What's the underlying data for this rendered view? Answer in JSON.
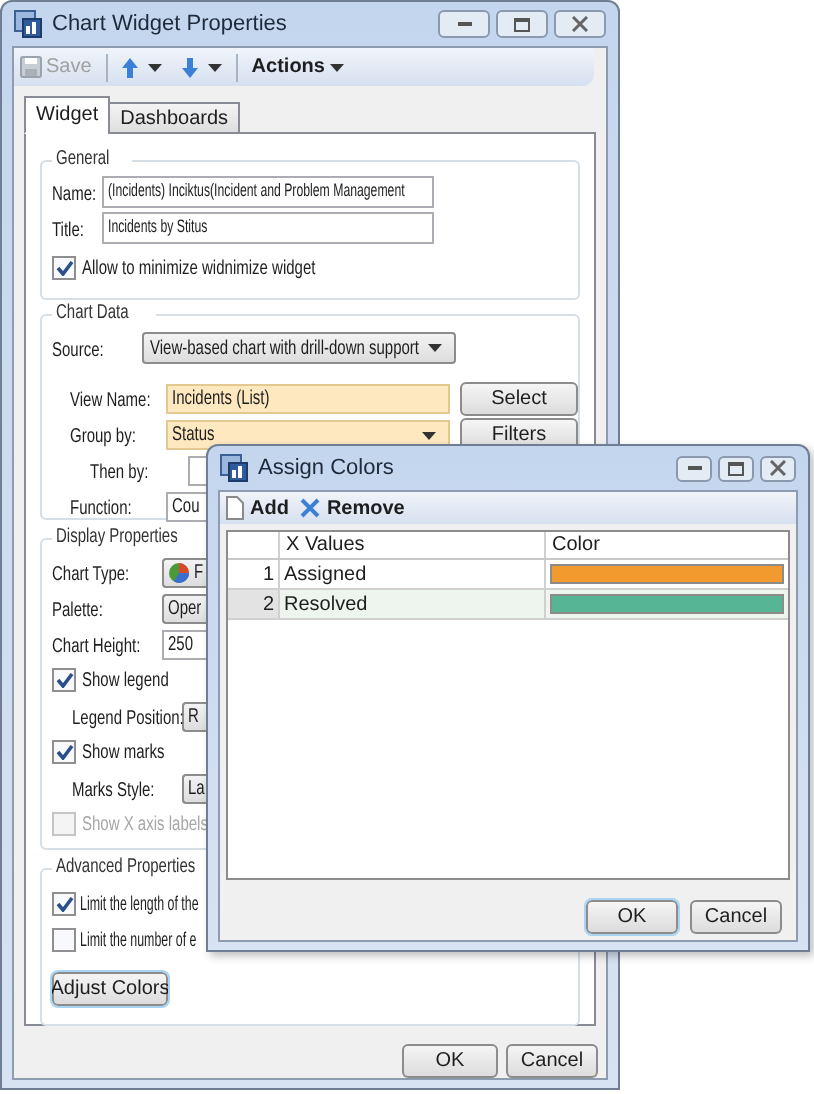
{
  "main_window": {
    "title": "Chart Widget Properties",
    "toolbar": {
      "save": {
        "label": "Save",
        "disabled": true
      },
      "actions": "Actions"
    },
    "tabs": [
      {
        "label": "Widget",
        "selected": true
      },
      {
        "label": "Dashboards",
        "selected": false
      }
    ],
    "general": {
      "heading": "General",
      "fields": [
        {
          "label": "Name:",
          "value": "(Incidents) Inciktus(Incident and Problem Management"
        },
        {
          "label": "Title:",
          "value": "Incidents by Stitus"
        }
      ],
      "checkbox": {
        "label": "Allow to minimize widnimize widget",
        "checked": true
      }
    },
    "data_section": {
      "heading": "Chart Data",
      "source": {
        "label": "Source:",
        "value": "View-based chart with drill-down support"
      },
      "rows": [
        {
          "kind": "field",
          "label": "View Name:",
          "value": "Incidents (List)",
          "required": true,
          "button": "Select"
        },
        {
          "kind": "dropdown",
          "label": "Group by:",
          "value": "Status",
          "required": true,
          "button": "Filters"
        },
        {
          "kind": "sub",
          "label": "Then by:",
          "required": false
        },
        {
          "kind": "short",
          "label": "Function:",
          "value": "Cou",
          "required": false
        }
      ]
    },
    "display_properties": {
      "heading": "Display Properties",
      "items": [
        {
          "kind": "icon_select",
          "label": "Chart Type:",
          "value": "F"
        },
        {
          "kind": "select",
          "label": "Palette:",
          "value": "Oper"
        },
        {
          "kind": "text",
          "label": "Chart Height:",
          "value": "250"
        },
        {
          "kind": "checkbox",
          "label": "Show legend",
          "checked": true,
          "disabled": false,
          "children": [
            {
              "kind": "select",
              "label": "Legend Position:",
              "value": "R"
            }
          ]
        },
        {
          "kind": "checkbox",
          "label": "Show marks",
          "checked": true,
          "disabled": false,
          "children": [
            {
              "kind": "select",
              "label": "Marks Style:",
              "value": "La"
            }
          ]
        },
        {
          "kind": "checkbox",
          "label": "Show X axis labels",
          "checked": false,
          "disabled": true
        }
      ]
    },
    "advanced_properties": {
      "heading": "Advanced Properties",
      "checkboxes": [
        {
          "label": "Limit the length of the",
          "checked": true
        },
        {
          "label": "Limit the number of e",
          "checked": false
        }
      ],
      "button": "Adjust Colors"
    },
    "buttons": [
      {
        "label": "OK"
      },
      {
        "label": "Cancel"
      }
    ]
  },
  "dialog": {
    "title": "Assign Colors",
    "toolbar": [
      "Add",
      "Remove"
    ],
    "columns": [
      "X Values",
      "Color"
    ],
    "rows": [
      {
        "number": "1",
        "value": "Assigned",
        "color": "#f39a2f",
        "selected": false
      },
      {
        "number": "2",
        "value": "Resolved",
        "color": "#55b595",
        "selected": true
      }
    ],
    "buttons": [
      {
        "label": "OK",
        "default": true
      },
      {
        "label": "Cancel",
        "default": false
      }
    ]
  }
}
